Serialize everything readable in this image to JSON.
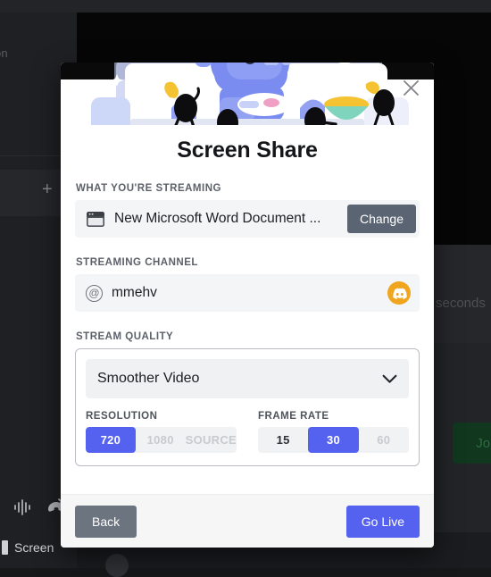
{
  "background": {
    "sidebar_truncated_label": "on",
    "add_button": "+",
    "voice_icon": "soundwave-icon",
    "hangup_icon": "phone-hangup-icon",
    "screen_label": "Screen",
    "seconds_text": "seconds",
    "join_button": "Join"
  },
  "modal": {
    "hero_illustration": "discord-screenshare-couch-illustration",
    "close_icon": "close-icon",
    "title": "Screen Share",
    "streaming": {
      "label": "WHAT YOU'RE STREAMING",
      "window_icon": "window-icon",
      "source_name": "New Microsoft Word Document ...",
      "change_button": "Change"
    },
    "channel": {
      "label": "STREAMING CHANNEL",
      "at_icon": "at-sign-icon",
      "name": "mmehv",
      "avatar_icon": "discord-logo-icon"
    },
    "quality": {
      "label": "STREAM QUALITY",
      "selected_preset": "Smoother Video",
      "chevron_icon": "chevron-down-icon",
      "resolution": {
        "title": "RESOLUTION",
        "options": [
          {
            "label": "720",
            "state": "active"
          },
          {
            "label": "1080",
            "state": "disabled"
          },
          {
            "label": "SOURCE",
            "state": "disabled"
          }
        ]
      },
      "frame_rate": {
        "title": "FRAME RATE",
        "options": [
          {
            "label": "15",
            "state": "enabled"
          },
          {
            "label": "30",
            "state": "active"
          },
          {
            "label": "60",
            "state": "disabled"
          }
        ]
      }
    },
    "footer": {
      "back_button": "Back",
      "go_live_button": "Go Live"
    }
  },
  "colors": {
    "blurple": "#5562F0",
    "slate_button": "#6C7480",
    "change_button": "#5B6472",
    "avatar_orange": "#F0A51F",
    "modal_bg": "#FFFFFF",
    "footer_bg": "#F6F6F7",
    "field_bg": "#F4F5F6"
  }
}
